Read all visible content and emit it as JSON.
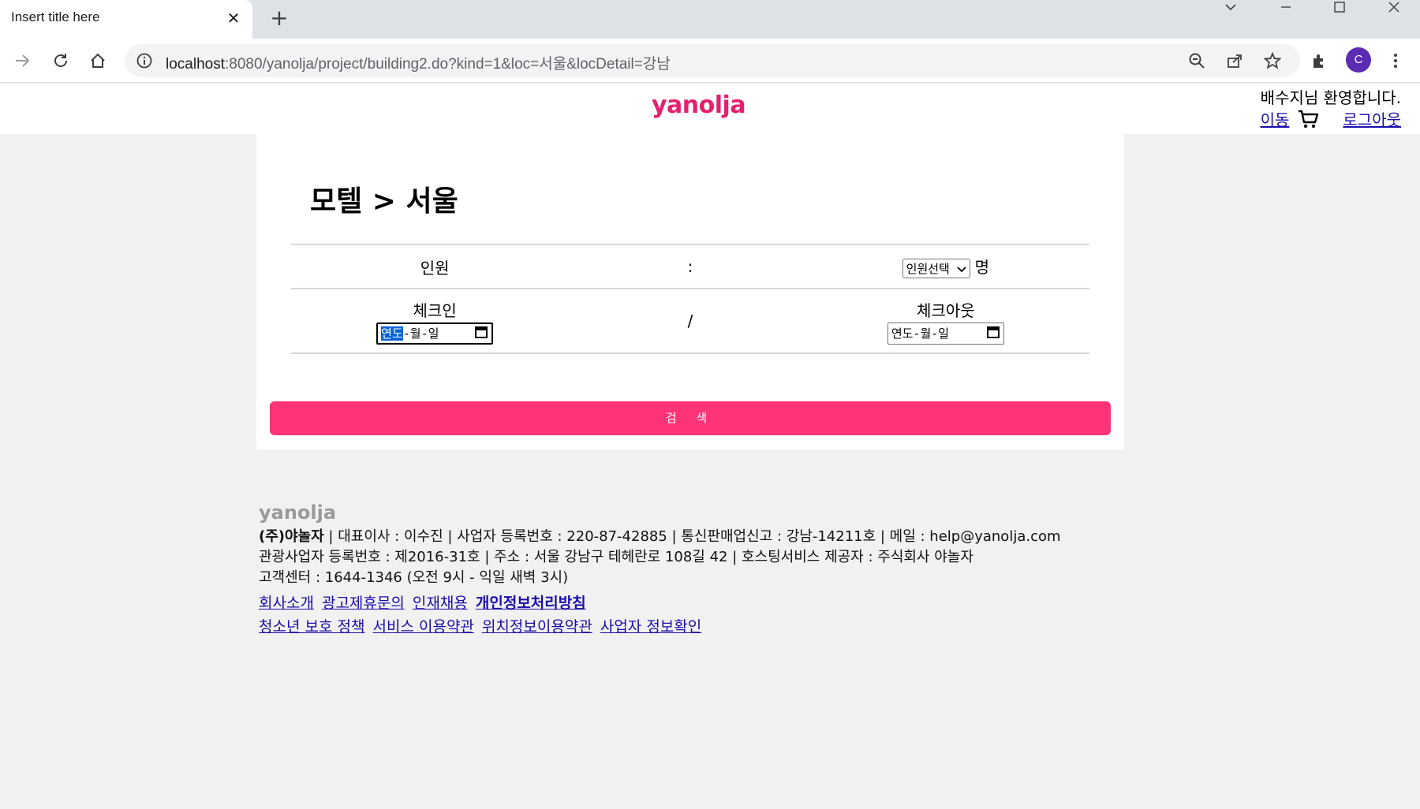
{
  "browser": {
    "tab_title": "Insert title here",
    "url_host": "localhost",
    "url_rest": ":8080/yanolja/project/building2.do?kind=1&loc=서울&locDetail=강남",
    "profile_initial": "C"
  },
  "header": {
    "logo": "yanolja",
    "welcome": "배수지님 환영합니다.",
    "move_link": "이동",
    "logout_link": "로그아웃"
  },
  "main": {
    "title": "모텔 > 서울",
    "guests_label": "인원",
    "guests_separator": ":",
    "guests_select": "인원선택",
    "guests_unit": "명",
    "checkin_label": "체크인",
    "date_separator": "/",
    "checkout_label": "체크아웃",
    "checkin_placeholder_year": "연도",
    "checkin_placeholder_rest": "-월-일",
    "checkout_placeholder": "연도-월-일",
    "search_button": "검 색"
  },
  "footer": {
    "logo": "yanolja",
    "company": "(주)야놀자",
    "line1_rest": " | 대표이사 : 이수진 | 사업자 등록번호 : 220-87-42885 | 통신판매업신고 : 강남-14211호 | 메일 : help@yanolja.com",
    "line2": "관광사업자 등록번호 : 제2016-31호 | 주소 : 서울 강남구 테헤란로 108길 42 | 호스팅서비스 제공자 : 주식회사 야놀자",
    "line3": "고객센터 : 1644-1346 (오전 9시 - 익일 새벽 3시)",
    "links_row1": [
      "회사소개",
      "광고제휴문의",
      "인재채용",
      "개인정보처리방침"
    ],
    "links_row2": [
      "청소년 보호 정책",
      "서비스 이용약관",
      "위치정보이용약관",
      "사업자 정보확인"
    ]
  },
  "colors": {
    "brand": "#e61e6e",
    "search_button": "#ff3478"
  }
}
